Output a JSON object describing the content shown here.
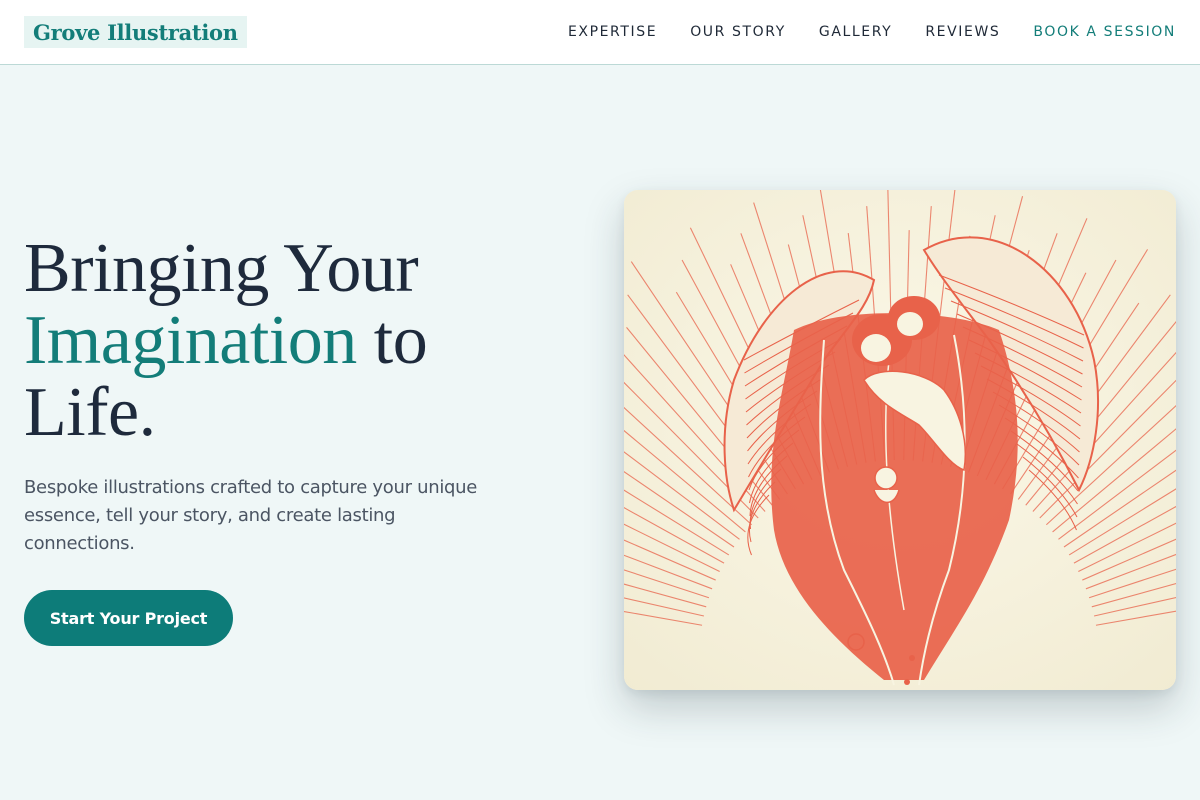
{
  "brand": {
    "name": "Grove Illustration"
  },
  "nav": {
    "items": [
      {
        "label": "EXPERTISE"
      },
      {
        "label": "OUR STORY"
      },
      {
        "label": "GALLERY"
      },
      {
        "label": "REVIEWS"
      },
      {
        "label": "BOOK A SESSION"
      }
    ]
  },
  "hero": {
    "title_part1": "Bringing Your",
    "title_accent": "Imagination",
    "title_part2": " to",
    "title_part3": "Life.",
    "subtitle": "Bespoke illustrations crafted to capture your unique essence, tell your story, and create lasting connections.",
    "cta_label": "Start Your Project"
  },
  "colors": {
    "accent": "#137d79",
    "page_bg": "#eff7f7",
    "text_dark": "#1e2a3c",
    "art_red": "#e8624a",
    "art_paper": "#f8f4e1"
  },
  "artwork": {
    "icon": "winged-angel-illustration"
  }
}
